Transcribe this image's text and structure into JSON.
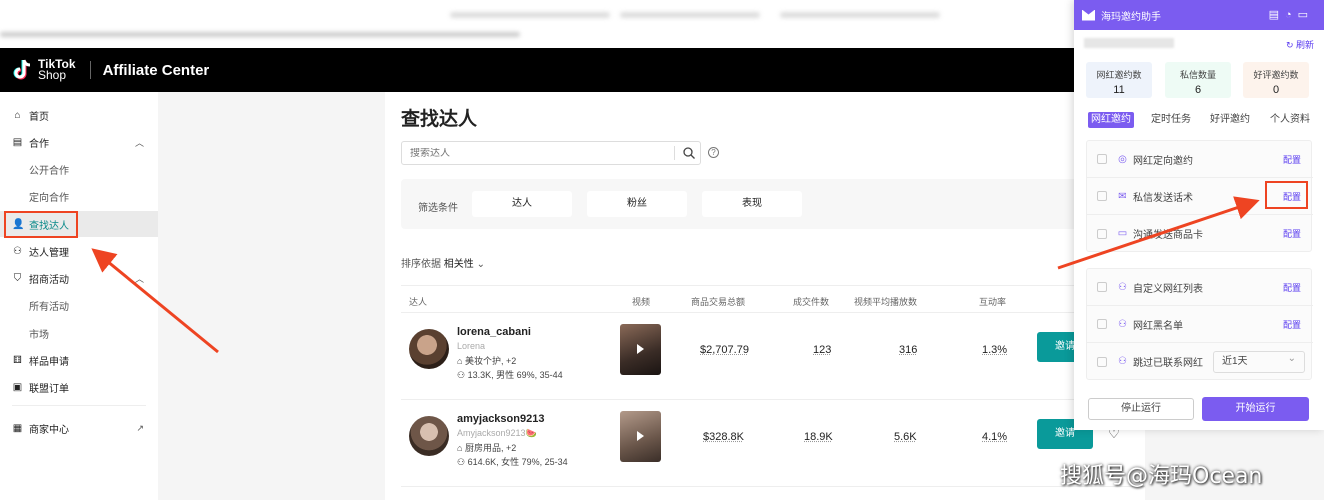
{
  "header": {
    "logo_line1": "TikTok",
    "logo_line2": "Shop",
    "title": "Affiliate Center"
  },
  "sidebar": {
    "items": [
      {
        "label": "首页",
        "icon": "home-icon"
      },
      {
        "label": "合作",
        "icon": "doc-icon"
      },
      {
        "label": "公开合作"
      },
      {
        "label": "定向合作"
      },
      {
        "label": "查找达人",
        "icon": "user-icon"
      },
      {
        "label": "达人管理",
        "icon": "users-icon"
      },
      {
        "label": "招商活动",
        "icon": "shield-icon"
      },
      {
        "label": "所有活动"
      },
      {
        "label": "市场"
      },
      {
        "label": "样品申请",
        "icon": "gift-icon"
      },
      {
        "label": "联盟订单",
        "icon": "clipboard-icon"
      },
      {
        "label": "商家中心",
        "icon": "store-icon"
      }
    ]
  },
  "main": {
    "title": "查找达人",
    "search_placeholder": "搜索达人",
    "filter_label": "筛选条件",
    "filters": [
      "达人",
      "粉丝",
      "表现"
    ],
    "sort_label": "排序依据",
    "sort_value": "相关性",
    "columns": [
      "达人",
      "视频",
      "商品交易总额",
      "成交件数",
      "视频平均播放数",
      "互动率"
    ],
    "rows": [
      {
        "name": "lorena_cabani",
        "handle": "Lorena",
        "category": "美妆个护, +2",
        "fans": "13.3K, 男性 69%, 35-44",
        "gmv": "$2,707.79",
        "units": "123",
        "avg_views": "316",
        "engagement": "1.3%",
        "action": "邀请"
      },
      {
        "name": "amyjackson9213",
        "handle": "Amyjackson9213🍉",
        "category": "厨房用品, +2",
        "fans": "614.6K, 女性 79%, 25-34",
        "gmv": "$328.8K",
        "units": "18.9K",
        "avg_views": "5.6K",
        "engagement": "4.1%",
        "action": "邀请"
      }
    ]
  },
  "panel": {
    "title": "海玛邀约助手",
    "refresh": "刷新",
    "stats": [
      {
        "label": "网红邀约数",
        "value": "11"
      },
      {
        "label": "私信数量",
        "value": "6"
      },
      {
        "label": "好评邀约数",
        "value": "0"
      }
    ],
    "tabs": [
      "网红邀约",
      "定时任务",
      "好评邀约",
      "个人资料"
    ],
    "group1": [
      {
        "label": "网红定向邀约",
        "cfg": "配置"
      },
      {
        "label": "私信发送话术",
        "cfg": "配置"
      },
      {
        "label": "沟通发送商品卡",
        "cfg": "配置"
      }
    ],
    "group2": [
      {
        "label": "自定义网红列表",
        "cfg": "配置"
      },
      {
        "label": "网红黑名单",
        "cfg": "配置"
      },
      {
        "label": "跳过已联系网红",
        "select": "近1天"
      }
    ],
    "stop_btn": "停止运行",
    "start_btn": "开始运行"
  },
  "watermark": "搜狐号@海玛Ocean",
  "colors": {
    "accent": "#7b5cf0",
    "teal": "#0a9a9a",
    "annotation_red": "#e42"
  }
}
